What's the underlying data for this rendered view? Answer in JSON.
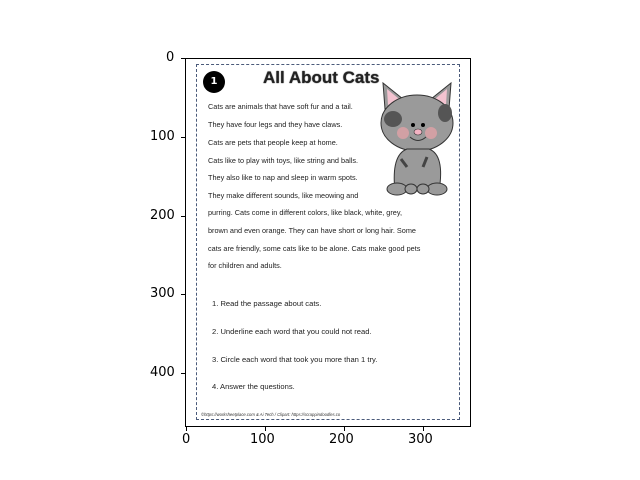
{
  "chart_data": {
    "type": "image",
    "title": "",
    "xlabel": "",
    "ylabel": "",
    "xlim": [
      0,
      361
    ],
    "ylim": [
      467,
      0
    ],
    "xticks": [
      "0",
      "100",
      "200",
      "300"
    ],
    "yticks": [
      "0",
      "100",
      "200",
      "300",
      "400"
    ],
    "image": {
      "badge": "1",
      "title": "All About Cats",
      "passage": [
        "Cats are animals that have soft fur and a tail.",
        "They have four legs and they have claws.",
        "Cats are pets that people keep at home.",
        "Cats like to play with toys, like string and balls.",
        "They also like to nap and sleep in warm spots.",
        "They make different sounds, like meowing and",
        "purring. Cats come in different colors, like black, white, grey,",
        "brown and even orange. They can have short or long hair. Some",
        "cats are friendly, some cats like to be alone. Cats make good pets",
        "for children and adults."
      ],
      "steps": [
        "1.  Read the passage about cats.",
        "2.  Underline each word that you could not read.",
        "3.  Circle each word that took you more than 1 try.",
        "4.  Answer the questions."
      ],
      "footer": "©https://worksheetplace.com & Ai Tech / Clipart: https://scrappindoodles.co"
    }
  }
}
